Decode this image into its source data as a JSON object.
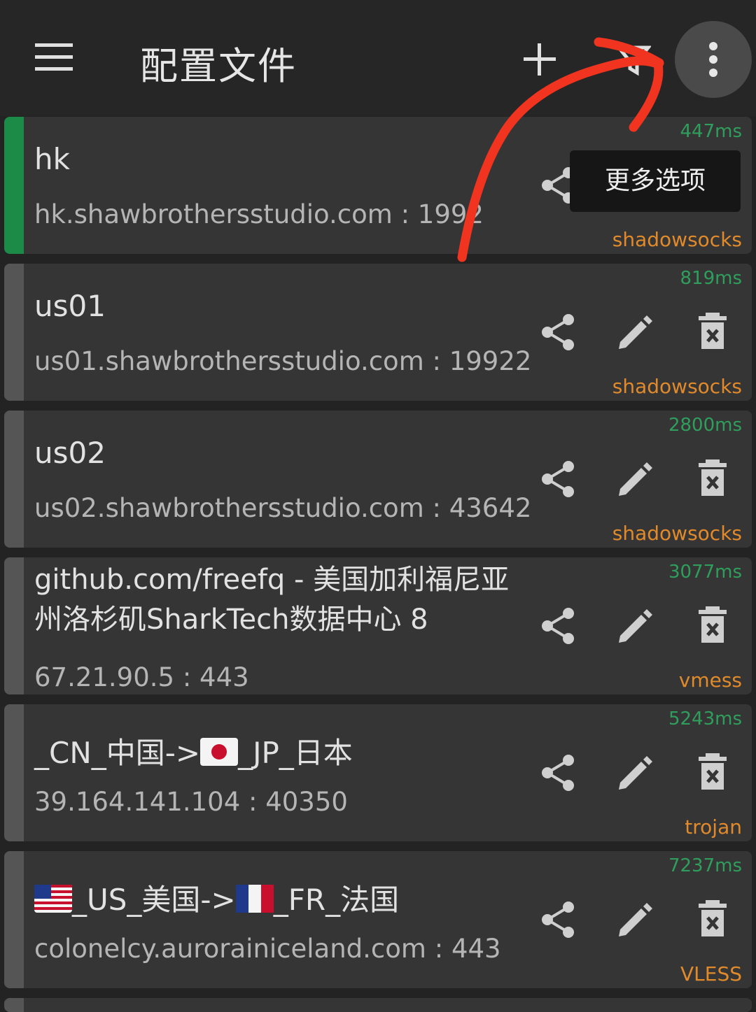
{
  "header": {
    "title": "配置文件"
  },
  "tooltip": {
    "text": "更多选项"
  },
  "profiles": [
    {
      "name": "hk",
      "address": "hk.shawbrothersstudio.com : 1992",
      "latency": "447ms",
      "protocol": "shadowsocks",
      "active": true
    },
    {
      "name": "us01",
      "address": "us01.shawbrothersstudio.com : 19922",
      "latency": "819ms",
      "protocol": "shadowsocks"
    },
    {
      "name": "us02",
      "address": "us02.shawbrothersstudio.com : 43642",
      "latency": "2800ms",
      "protocol": "shadowsocks"
    },
    {
      "name": "github.com/freefq - 美国加利福尼亚州洛杉矶SharkTech数据中心 8",
      "address": "67.21.90.5 : 443",
      "latency": "3077ms",
      "protocol": "vmess"
    },
    {
      "name_part1": "_CN_中国->",
      "name_part2": "_JP_日本",
      "address": "39.164.141.104 : 40350",
      "latency": "5243ms",
      "protocol": "trojan"
    },
    {
      "name_part1": "_US_美国->",
      "name_part2": "_FR_法国",
      "address": "colonelcy.aurorainiceland.com : 443",
      "latency": "7237ms",
      "protocol": "VLESS"
    }
  ],
  "colors": {
    "active_bar": "#1b8b47",
    "latency": "#2f9e5c",
    "protocol": "#e08a2c",
    "annotation": "#f0341f"
  },
  "icons": [
    "menu-icon",
    "add-icon",
    "filter-icon",
    "more-vert-icon",
    "share-icon",
    "edit-icon",
    "delete-icon",
    "flag-jp-icon",
    "flag-us-icon",
    "flag-fr-icon"
  ]
}
